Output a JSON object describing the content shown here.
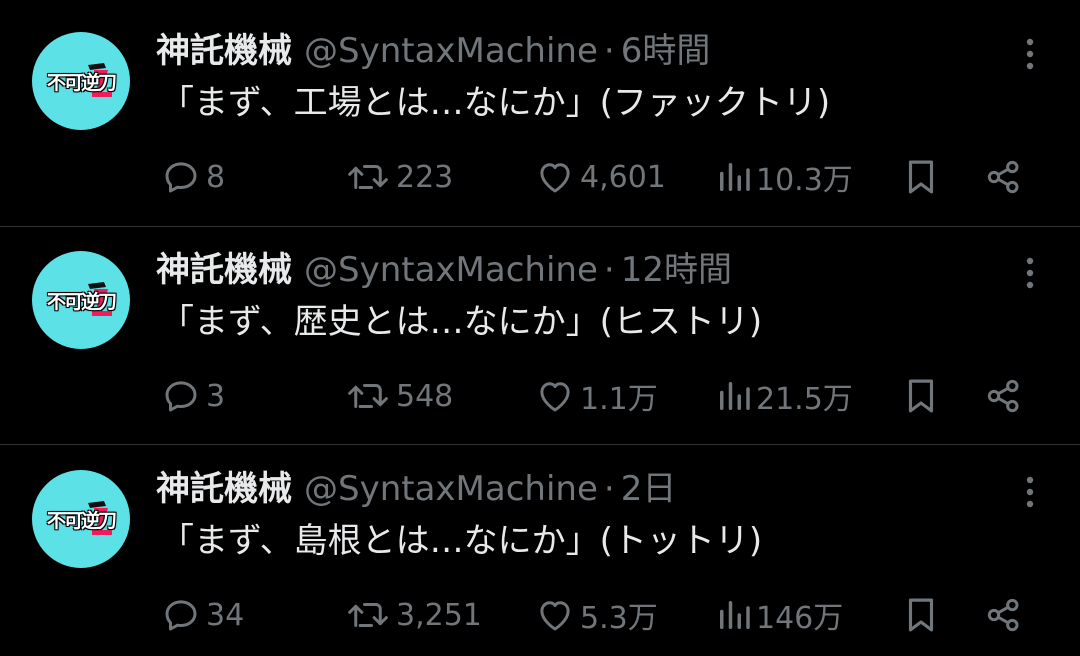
{
  "colors": {
    "background": "#000000",
    "text_primary": "#e7e9ea",
    "text_secondary": "#71767b",
    "divider": "#2f3336",
    "avatar_bg": "#5ce1e6",
    "avatar_accent": "#f21c5b"
  },
  "icons": {
    "reply": "speech-bubble-icon",
    "retweet": "retweet-arrows-icon",
    "like": "heart-icon",
    "views": "bar-chart-icon",
    "bookmark": "bookmark-icon",
    "share": "share-icon",
    "more": "vertical-ellipsis-icon"
  },
  "tweets": [
    {
      "avatar_text": "不可逆刀",
      "display_name": "神託機械",
      "handle": "@SyntaxMachine",
      "separator": "·",
      "time": "6時間",
      "text": "「まず、工場とは…なにか」(ファックトリ)",
      "replies": "8",
      "retweets": "223",
      "likes": "4,601",
      "views": "10.3万"
    },
    {
      "avatar_text": "不可逆刀",
      "display_name": "神託機械",
      "handle": "@SyntaxMachine",
      "separator": "·",
      "time": "12時間",
      "text": "「まず、歴史とは…なにか」(ヒストリ)",
      "replies": "3",
      "retweets": "548",
      "likes": "1.1万",
      "views": "21.5万"
    },
    {
      "avatar_text": "不可逆刀",
      "display_name": "神託機械",
      "handle": "@SyntaxMachine",
      "separator": "·",
      "time": "2日",
      "text": "「まず、島根とは…なにか」(トットリ)",
      "replies": "34",
      "retweets": "3,251",
      "likes": "5.3万",
      "views": "146万"
    }
  ]
}
